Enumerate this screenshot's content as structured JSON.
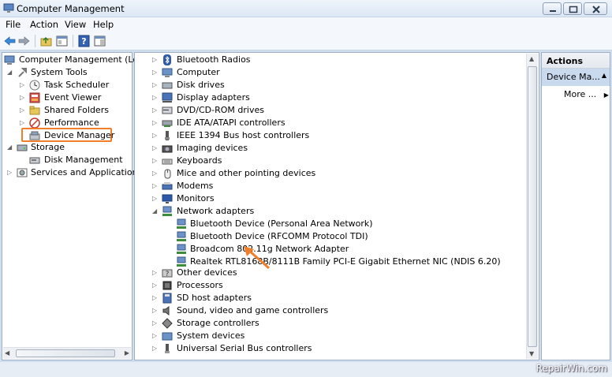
{
  "window": {
    "title": "Computer Management"
  },
  "menu": [
    "File",
    "Action",
    "View",
    "Help"
  ],
  "toolbar_icons": [
    "back-arrow-icon",
    "forward-arrow-icon",
    "up-folder-icon",
    "properties-icon",
    "help-icon",
    "show-hide-icon"
  ],
  "left_tree": {
    "root": "Computer Management (Local",
    "system_tools": "System Tools",
    "task_scheduler": "Task Scheduler",
    "event_viewer": "Event Viewer",
    "shared_folders": "Shared Folders",
    "performance": "Performance",
    "device_manager": "Device Manager",
    "storage": "Storage",
    "disk_management": "Disk Management",
    "services": "Services and Applications"
  },
  "devices": {
    "bluetooth_radios": "Bluetooth Radios",
    "computer": "Computer",
    "disk_drives": "Disk drives",
    "display_adapters": "Display adapters",
    "dvd": "DVD/CD-ROM drives",
    "ide": "IDE ATA/ATAPI controllers",
    "ieee": "IEEE 1394 Bus host controllers",
    "imaging": "Imaging devices",
    "keyboards": "Keyboards",
    "mice": "Mice and other pointing devices",
    "modems": "Modems",
    "monitors": "Monitors",
    "network_adapters": "Network adapters",
    "net_bt_pan": "Bluetooth Device (Personal Area Network)",
    "net_bt_rfcomm": "Bluetooth Device (RFCOMM Protocol TDI)",
    "net_broadcom": "Broadcom 802.11g Network Adapter",
    "net_realtek": "Realtek RTL8168B/8111B Family PCI-E Gigabit Ethernet NIC (NDIS 6.20)",
    "other": "Other devices",
    "processors": "Processors",
    "sd_host": "SD host adapters",
    "sound": "Sound, video and game controllers",
    "storage_ctrl": "Storage controllers",
    "system_devices": "System devices",
    "usb": "Universal Serial Bus controllers"
  },
  "actions": {
    "header": "Actions",
    "context": "Device Ma...",
    "more": "More ..."
  },
  "watermark": "RepairWin.com",
  "colors": {
    "highlight": "#f07e2a",
    "selection": "#c9daee"
  }
}
